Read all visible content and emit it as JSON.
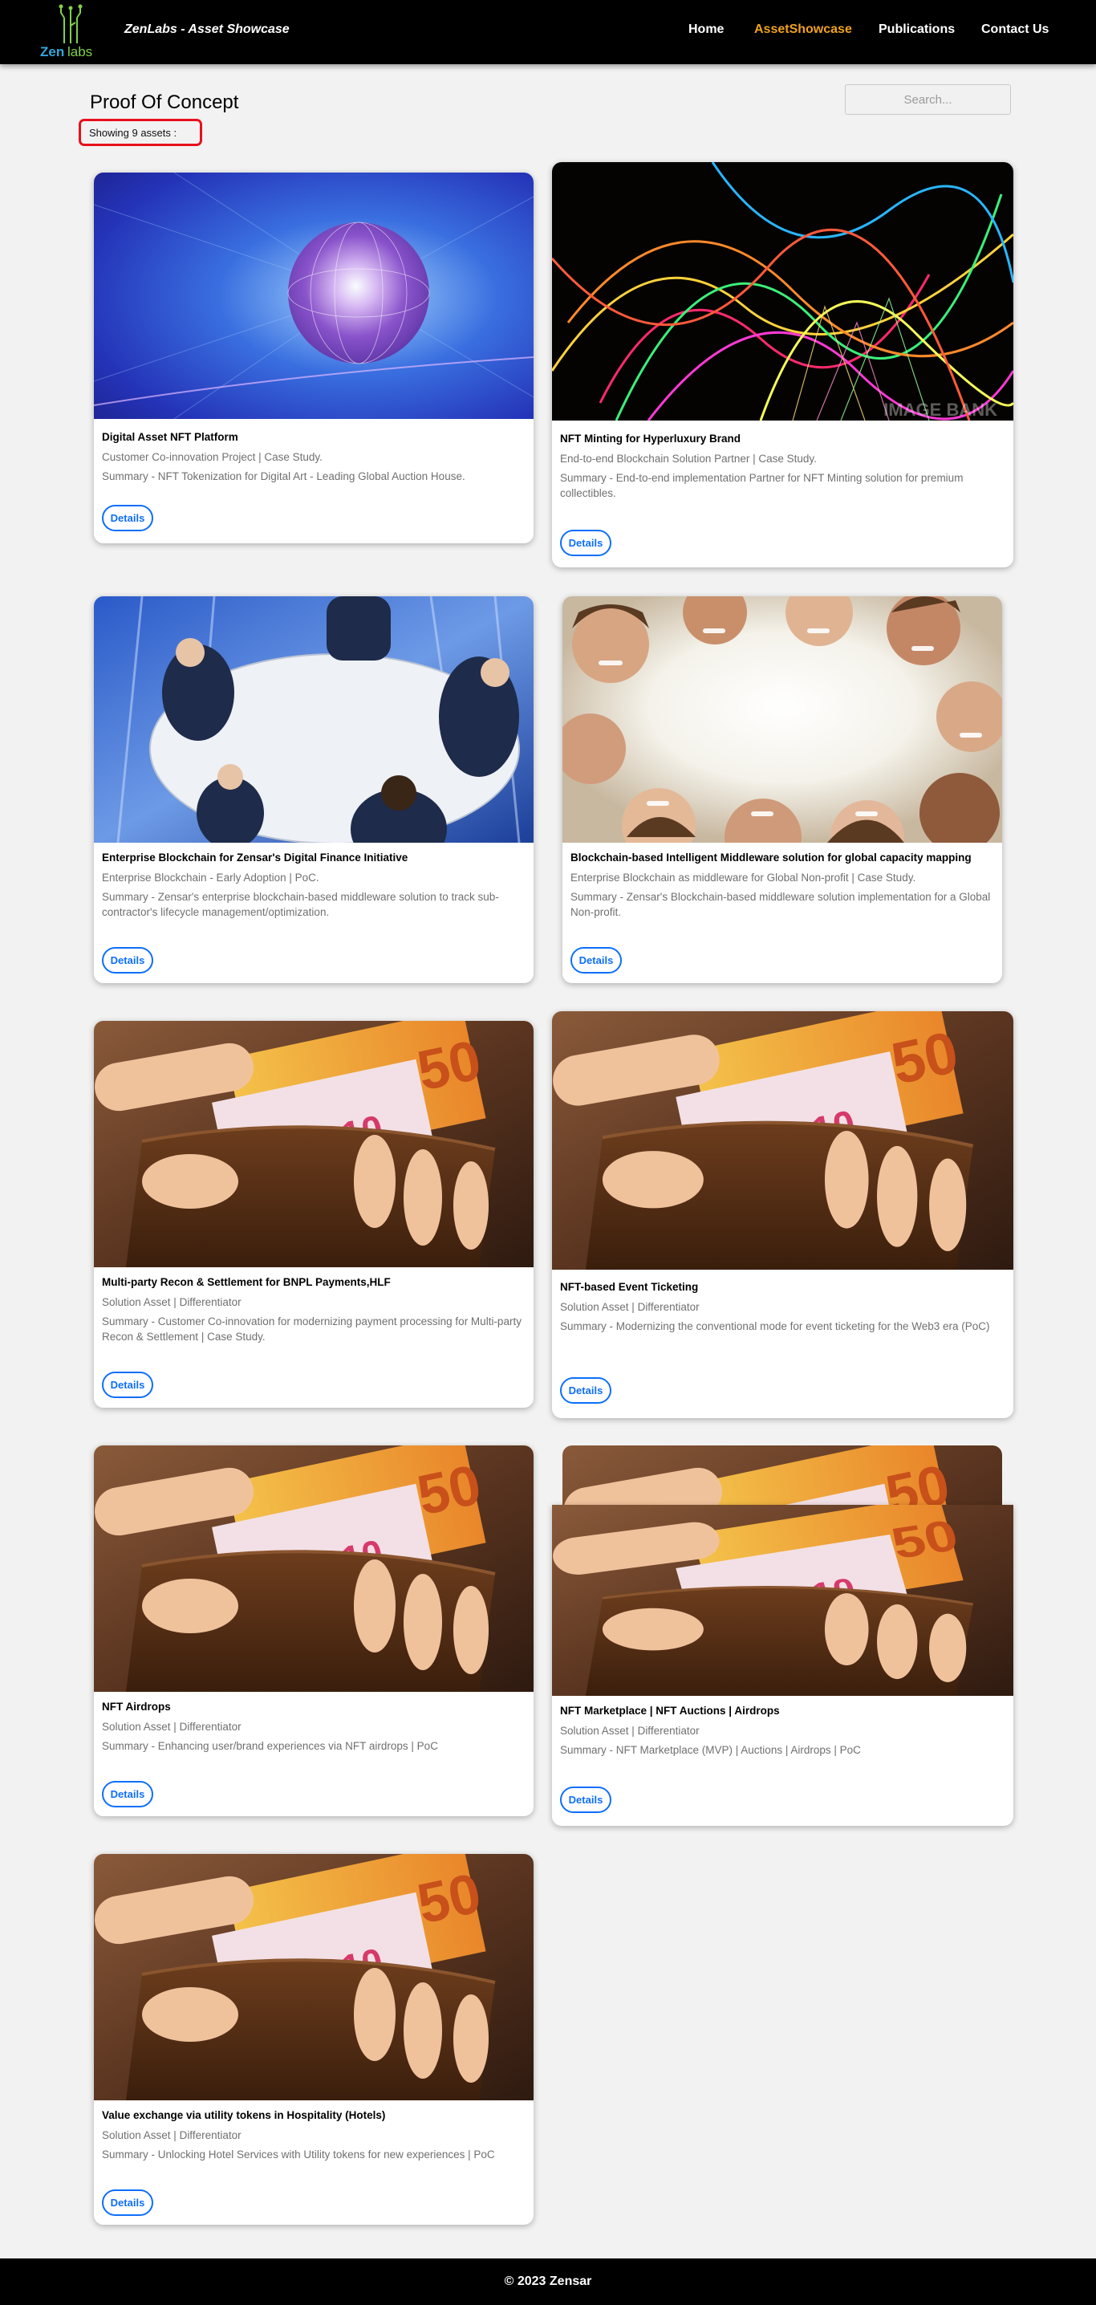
{
  "brand": {
    "title": "ZenLabs - Asset Showcase",
    "logo_text": "Zenlabs"
  },
  "nav": [
    {
      "label": "Home",
      "active": false
    },
    {
      "label": "AssetShowcase",
      "active": true
    },
    {
      "label": "Publications",
      "active": false
    },
    {
      "label": "Contact Us",
      "active": false
    }
  ],
  "page": {
    "title": "Proof Of Concept",
    "count_text": "Showing 9 assets :"
  },
  "search": {
    "placeholder": "Search...",
    "value": ""
  },
  "cards": [
    {
      "title": "Digital Asset NFT Platform",
      "category": "Customer Co-innovation Project | Case Study.",
      "summary": "Summary - NFT Tokenization for Digital Art - Leading Global Auction House.",
      "button": "Details",
      "image": "sphere"
    },
    {
      "title": "NFT Minting for Hyperluxury Brand",
      "category": "End-to-end Blockchain Solution Partner | Case Study.",
      "summary": "Summary - End-to-end implementation Partner for NFT Minting solution for premium collectibles.",
      "button": "Details",
      "image": "light-streaks",
      "image_watermark": "IMAGE BANK"
    },
    {
      "title": "Enterprise Blockchain for Zensar's Digital Finance Initiative",
      "category": "Enterprise Blockchain - Early Adoption | PoC.",
      "summary": "Summary - Zensar's enterprise blockchain-based middleware solution to track sub-contractor's lifecycle management/optimization.",
      "button": "Details",
      "image": "meeting"
    },
    {
      "title": "Blockchain-based Intelligent Middleware solution for global capacity mapping",
      "category": "Enterprise Blockchain as middleware for Global Non-profit | Case Study.",
      "summary": "Summary - Zensar's Blockchain-based middleware solution implementation for a Global Non-profit.",
      "button": "Details",
      "image": "faces-circle"
    },
    {
      "title": "Multi-party Recon & Settlement for BNPL Payments,HLF",
      "category": "Solution Asset | Differentiator",
      "summary": "Summary - Customer Co-innovation for modernizing payment processing for Multi-party Recon & Settlement | Case Study.",
      "button": "Details",
      "image": "wallet"
    },
    {
      "title": "NFT-based Event Ticketing",
      "category": "Solution Asset | Differentiator",
      "summary": "Summary - Modernizing the conventional mode for event ticketing for the Web3 era (PoC)",
      "button": "Details",
      "image": "wallet"
    },
    {
      "title": "NFT Airdrops",
      "category": "Solution Asset | Differentiator",
      "summary": "Summary - Enhancing user/brand experiences via NFT airdrops | PoC",
      "button": "Details",
      "image": "wallet"
    },
    {
      "title": "NFT Marketplace | NFT Auctions | Airdrops",
      "category": "Solution Asset | Differentiator",
      "summary": "Summary - NFT Marketplace (MVP) | Auctions | Airdrops | PoC",
      "button": "Details",
      "image": "wallet"
    },
    {
      "title": "Value exchange via utility tokens in Hospitality (Hotels)",
      "category": "Solution Asset | Differentiator",
      "summary": "Summary - Unlocking Hotel Services with Utility tokens for new experiences | PoC",
      "button": "Details",
      "image": "wallet"
    }
  ],
  "footer": {
    "text": "© 2023 Zensar"
  }
}
